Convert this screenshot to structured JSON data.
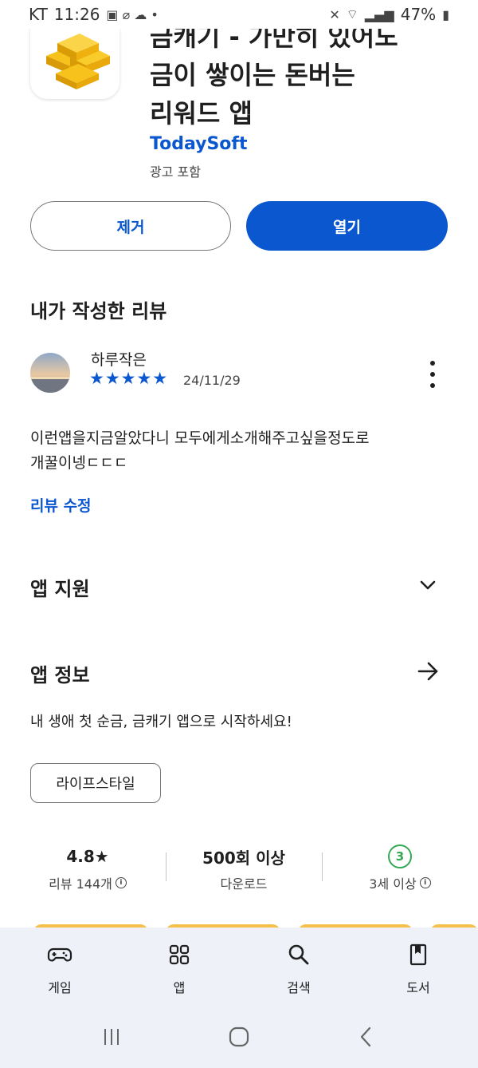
{
  "status_bar": {
    "carrier": "KT",
    "time": "11:26",
    "battery": "47%"
  },
  "app": {
    "title_line1": "금캐기 - 가만히 있어도",
    "title_line2": "금이 쌓이는 돈버는",
    "title_line3": "리워드 앱",
    "developer": "TodaySoft",
    "ads_note": "광고 포함"
  },
  "actions": {
    "remove_label": "제거",
    "open_label": "열기"
  },
  "my_review": {
    "section_title": "내가 작성한 리뷰",
    "reviewer_name": "하루작은",
    "stars": "★★★★★",
    "rating": 5,
    "date": "24/11/29",
    "text_line1": "이런앱을지금알았다니 모두에게소개해주고싶을정도로",
    "text_line2": "개꿀이넹ㄷㄷㄷ",
    "edit_label": "리뷰 수정"
  },
  "app_support": {
    "title": "앱 지원"
  },
  "app_info": {
    "title": "앱 정보",
    "description": "내 생애 첫 순금, 금캐기 앱으로 시작하세요!",
    "category_chip": "라이프스타일"
  },
  "stats": {
    "rating_value": "4.8★",
    "rating_label": "리뷰 144개",
    "downloads_value": "500회 이상",
    "downloads_label": "다운로드",
    "age_badge": "3",
    "age_label": "3세 이상"
  },
  "bottom_nav": {
    "items": [
      {
        "label": "게임",
        "icon": "gamepad-icon"
      },
      {
        "label": "앱",
        "icon": "apps-grid-icon"
      },
      {
        "label": "검색",
        "icon": "search-icon"
      },
      {
        "label": "도서",
        "icon": "book-icon"
      }
    ]
  },
  "colors": {
    "accent": "#0b57d0",
    "nav_bg": "#eef1f8",
    "age_green": "#34a853"
  }
}
